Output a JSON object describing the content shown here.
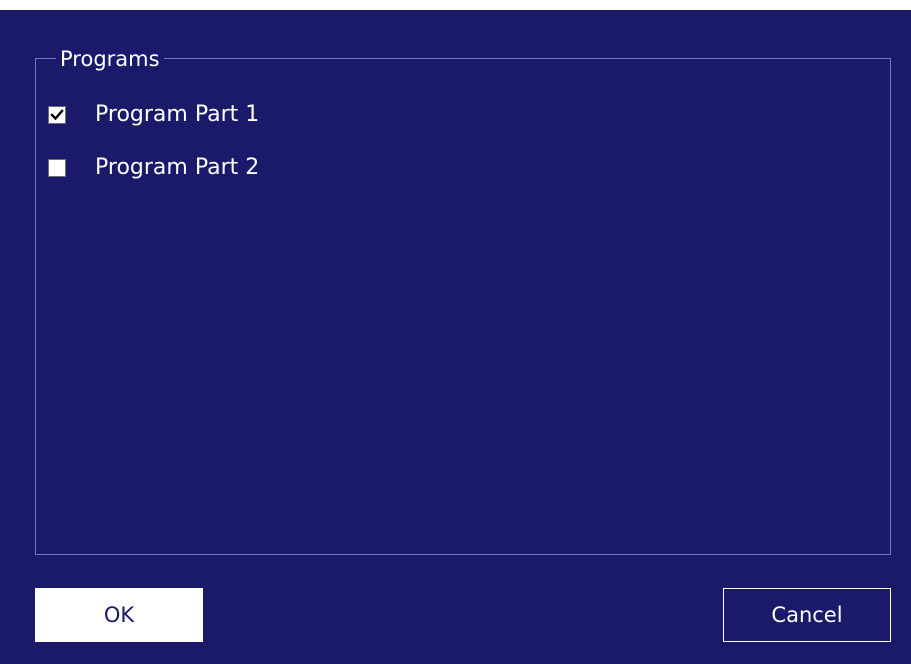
{
  "dialog": {
    "groupbox": {
      "legend": "Programs",
      "items": [
        {
          "label": "Program Part 1",
          "checked": true
        },
        {
          "label": "Program Part 2",
          "checked": false
        }
      ]
    },
    "buttons": {
      "ok_label": "OK",
      "cancel_label": "Cancel"
    }
  },
  "colors": {
    "background": "#1b1a6a",
    "groupbox_border": "#6a78c8",
    "text": "#ffffff",
    "ok_button_background": "#ffffff"
  },
  "icons": {
    "checked_mark": "check-icon"
  }
}
